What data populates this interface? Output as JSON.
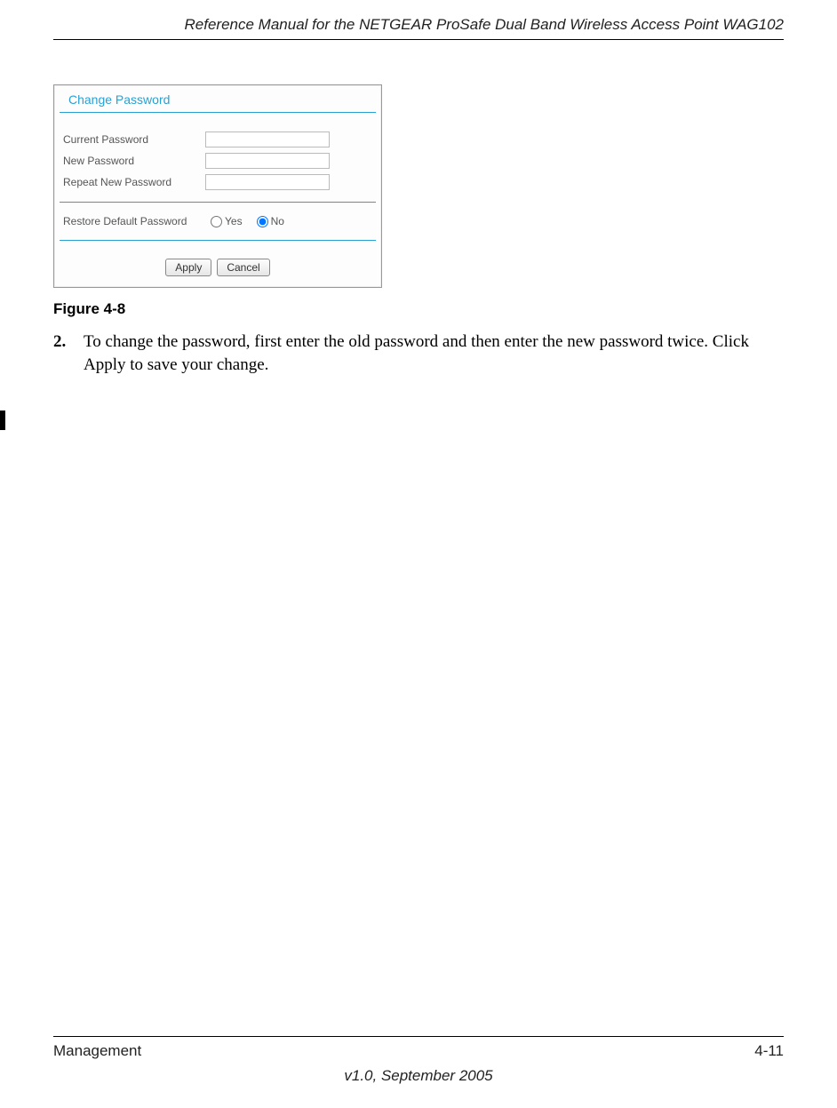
{
  "header": {
    "title": "Reference Manual for the NETGEAR ProSafe Dual Band Wireless Access Point WAG102"
  },
  "panel": {
    "title": "Change Password",
    "fields": {
      "current": "Current Password",
      "new": "New Password",
      "repeat": "Repeat New Password"
    },
    "restore": {
      "label": "Restore Default Password",
      "yes": "Yes",
      "no": "No"
    },
    "buttons": {
      "apply": "Apply",
      "cancel": "Cancel"
    }
  },
  "caption": "Figure 4-8",
  "step": {
    "num": "2.",
    "text": "To change the password, first enter the old password and then enter the new password twice. Click Apply to save your change."
  },
  "footer": {
    "section": "Management",
    "page": "4-11",
    "version": "v1.0, September 2005"
  }
}
